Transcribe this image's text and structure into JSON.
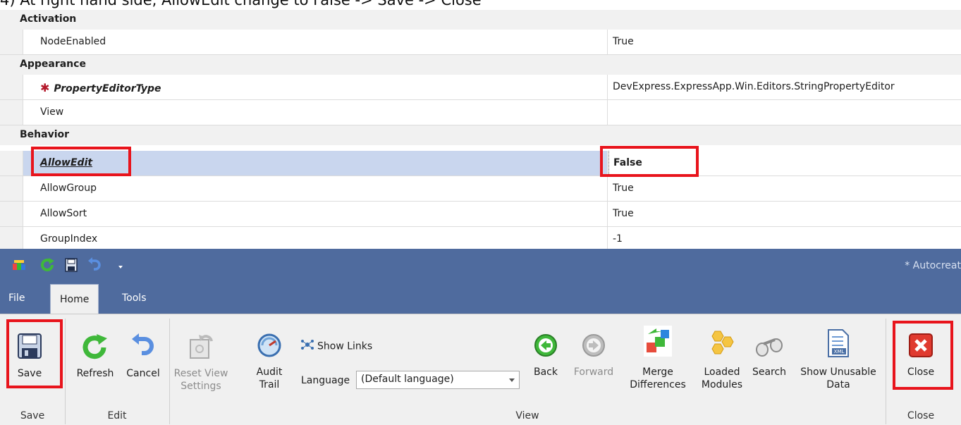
{
  "caption": "4) At right hand side, AllowEdit change to False -> Save -> Close",
  "property_grid": {
    "categories": {
      "activation": "Activation",
      "appearance": "Appearance",
      "behavior": "Behavior"
    },
    "rows": {
      "node_enabled": {
        "name": "NodeEnabled",
        "value": "True"
      },
      "property_editor_type": {
        "name": "PropertyEditorType",
        "value": "DevExpress.ExpressApp.Win.Editors.StringPropertyEditor"
      },
      "view": {
        "name": "View",
        "value": ""
      },
      "allow_edit": {
        "name": "AllowEdit",
        "value": "False"
      },
      "allow_group": {
        "name": "AllowGroup",
        "value": "True"
      },
      "allow_sort": {
        "name": "AllowSort",
        "value": "True"
      },
      "group_index": {
        "name": "GroupIndex",
        "value": "-1"
      }
    }
  },
  "window": {
    "title": "* Autocreat"
  },
  "ribbon": {
    "tabs": [
      "File",
      "Home",
      "Tools"
    ],
    "active_tab": "Home",
    "buttons": {
      "save": "Save",
      "refresh": "Refresh",
      "cancel": "Cancel",
      "reset_view_1": "Reset View",
      "reset_view_2": "Settings",
      "audit_1": "Audit",
      "audit_2": "Trail",
      "show_links": "Show Links",
      "language_label": "Language",
      "language_value": "(Default language)",
      "back": "Back",
      "forward": "Forward",
      "merge_1": "Merge",
      "merge_2": "Differences",
      "loaded_1": "Loaded",
      "loaded_2": "Modules",
      "search": "Search",
      "unusable_1": "Show Unusable",
      "unusable_2": "Data",
      "close": "Close"
    },
    "groups": {
      "save": "Save",
      "edit": "Edit",
      "view": "View",
      "close": "Close"
    }
  },
  "colors": {
    "highlight": "#e8141c",
    "ribbon_header": "#4f6b9e",
    "selection": "#c9d6ee"
  }
}
